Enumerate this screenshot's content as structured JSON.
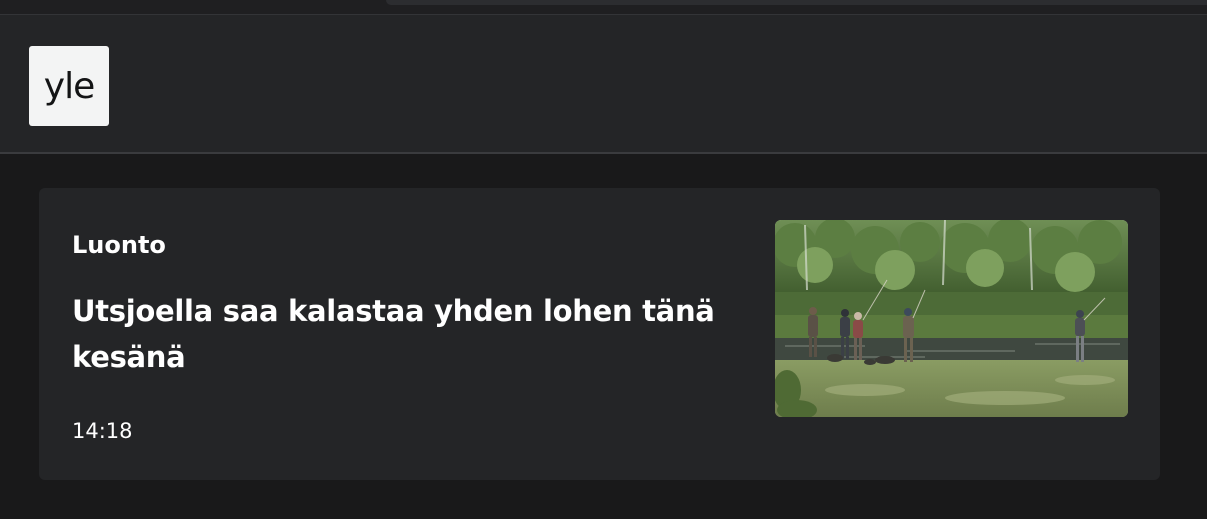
{
  "logo": {
    "text": "yle"
  },
  "article": {
    "category": "Luonto",
    "headline": "Utsjoella saa kalastaa yhden lohen tänä kesänä",
    "time": "14:18"
  },
  "colors": {
    "page_background": "#19191a",
    "card_background": "#242527",
    "text": "#ffffff",
    "logo_background": "#f3f4f4"
  }
}
